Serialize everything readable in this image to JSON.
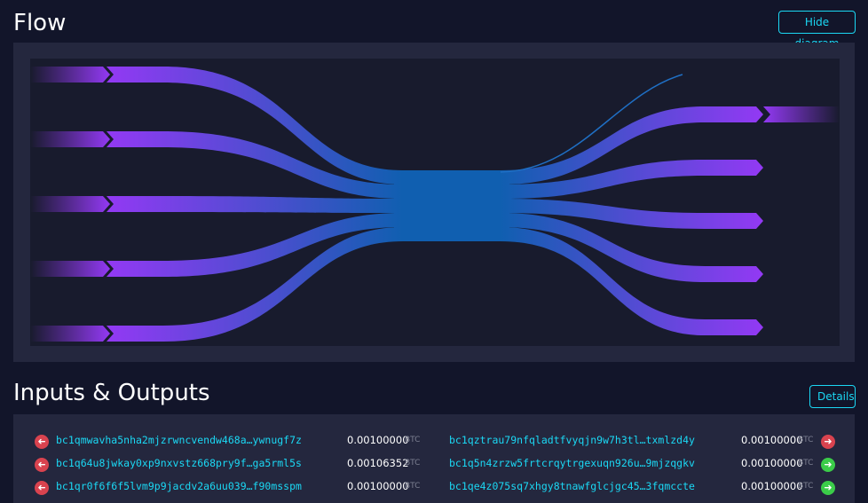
{
  "flow": {
    "title": "Flow",
    "hide_label": "Hide diagram",
    "colors": {
      "purple": "#9339f4",
      "blue": "#105fb0"
    },
    "inputs": 5,
    "outputs": 5
  },
  "io": {
    "title": "Inputs & Outputs",
    "details_label": "Details",
    "rows": [
      {
        "in_icon": "arrow-left-icon",
        "in_status": "red",
        "in_addr": "bc1qmwavha5nha2mjzrwncvendw468a…ywnugf7z",
        "in_amount": "0.00100000",
        "in_unit": "BTC",
        "out_addr": "bc1qztrau79nfqladtfvyqjn9w7h3tl…txmlzd4y",
        "out_amount": "0.00100000",
        "out_unit": "BTC",
        "out_icon": "arrow-right-icon",
        "out_status": "red"
      },
      {
        "in_icon": "arrow-left-icon",
        "in_status": "red",
        "in_addr": "bc1q64u8jwkay0xp9nxvstz668pry9f…ga5rml5s",
        "in_amount": "0.00106352",
        "in_unit": "BTC",
        "out_addr": "bc1q5n4zrzw5frtcrqytrgexuqn926u…9mjzqgkv",
        "out_amount": "0.00100000",
        "out_unit": "BTC",
        "out_icon": "arrow-right-icon",
        "out_status": "green"
      },
      {
        "in_icon": "arrow-left-icon",
        "in_status": "red",
        "in_addr": "bc1qr0f6f6f5lvm9p9jacdv2a6uu039…f90msspm",
        "in_amount": "0.00100000",
        "in_unit": "BTC",
        "out_addr": "bc1qe4z075sq7xhgy8tnawfglcjgc45…3fqmccte",
        "out_amount": "0.00100000",
        "out_unit": "BTC",
        "out_icon": "arrow-right-icon",
        "out_status": "green"
      }
    ]
  }
}
